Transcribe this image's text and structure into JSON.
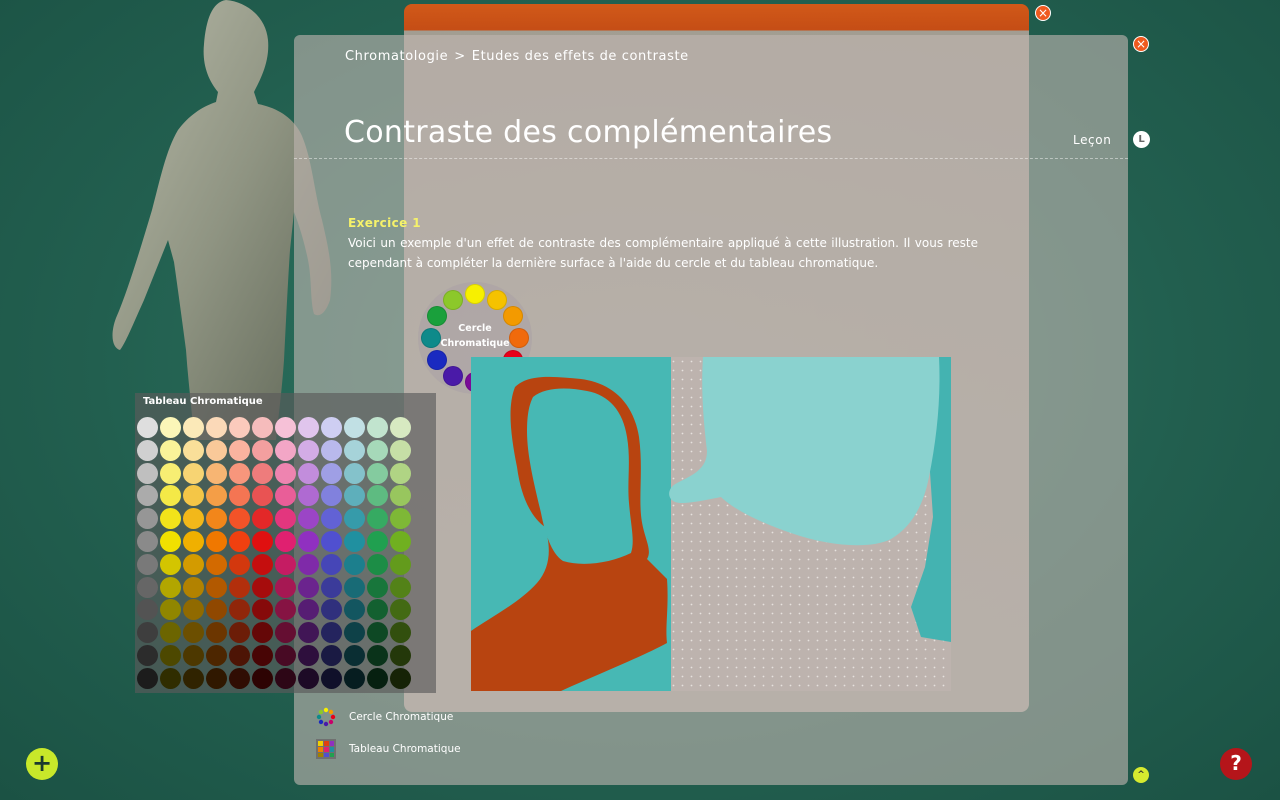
{
  "breadcrumb": {
    "root": "Chromatologie",
    "separator": ">",
    "current": "Etudes des effets de contraste"
  },
  "page": {
    "title": "Contraste des complémentaires"
  },
  "lecon": {
    "label": "Leçon",
    "badge": "L"
  },
  "exercise": {
    "title": "Exercice 1",
    "text": "Voici un exemple d'un effet de contraste des complémentaire appliqué à cette illustration. Il vous reste cependant à compléter la dernière surface à l'aide du cercle et du tableau chromatique."
  },
  "wheel": {
    "label_line1": "Cercle",
    "label_line2": "Chromatique",
    "colors": [
      "#f7f000",
      "#f5c200",
      "#f39a00",
      "#f06a0c",
      "#e8001a",
      "#c8006a",
      "#7a0a98",
      "#4a1aa8",
      "#1a2ac0",
      "#0e8a8a",
      "#1aa03c",
      "#8cc82a"
    ]
  },
  "palette": {
    "title": "Tableau Chromatique",
    "hues": [
      "#8a8a8a",
      "#f0e000",
      "#f0b000",
      "#f07800",
      "#f04010",
      "#e01010",
      "#e02070",
      "#9030c0",
      "#5050d0",
      "#2090a0",
      "#20a050",
      "#70b020"
    ]
  },
  "tools": {
    "wheel_label": "Cercle Chromatique",
    "table_label": "Tableau Chromatique"
  },
  "controls": {
    "close": "×",
    "add": "+",
    "help": "?",
    "up": "^"
  },
  "colors": {
    "accent_orange": "#ef5a1f",
    "add_green": "#c8e82a",
    "help_red": "#b5151a",
    "teal": "#47b8b4",
    "rust": "#b84410"
  }
}
